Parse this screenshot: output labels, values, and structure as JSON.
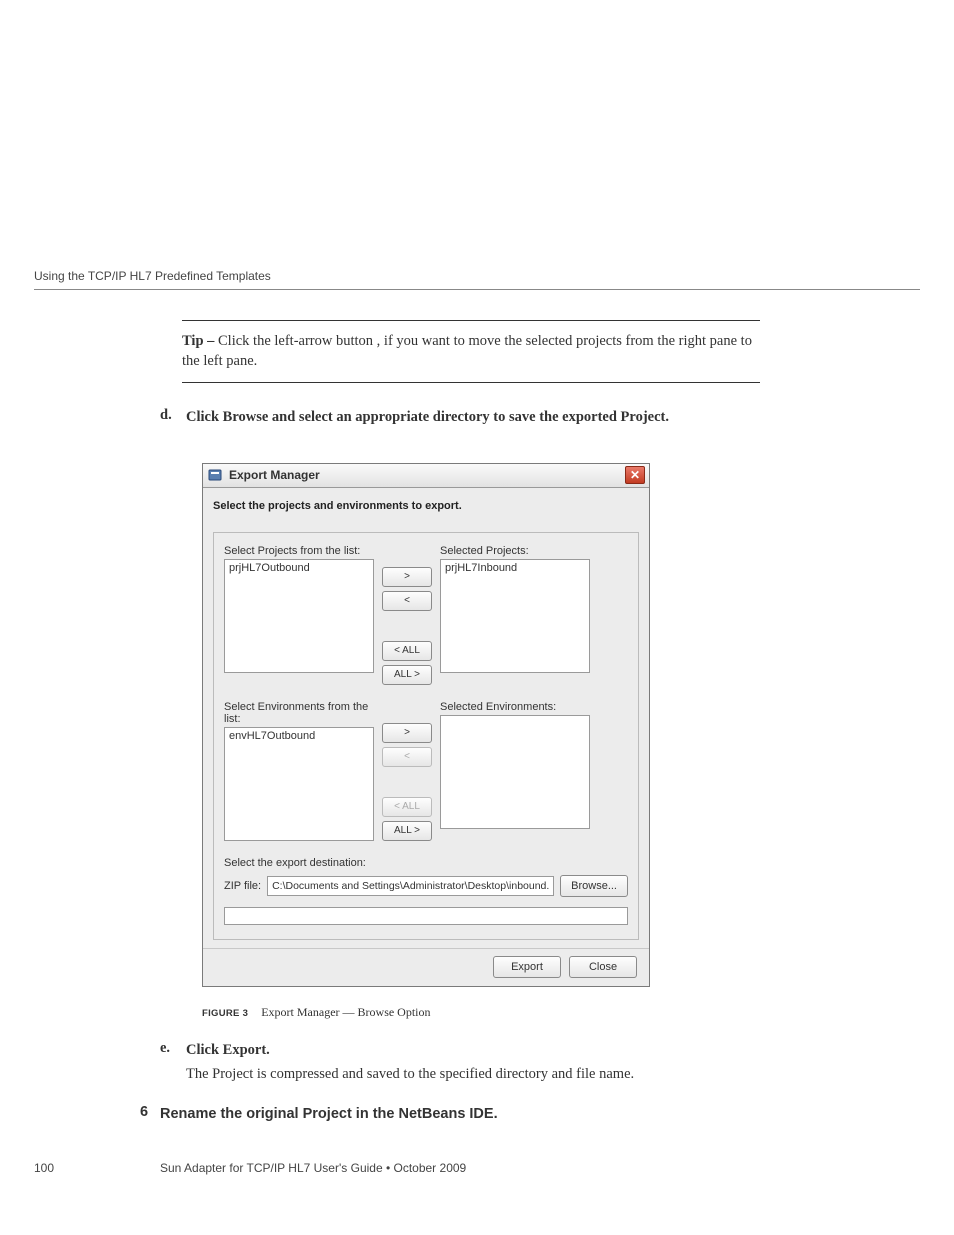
{
  "header": {
    "section_title": "Using the TCP/IP HL7 Predefined Templates"
  },
  "tip": {
    "label": "Tip –",
    "text": " Click the left-arrow button , if you want to move the selected projects from the right pane to the left pane."
  },
  "steps": {
    "d": {
      "marker": "d.",
      "text": "Click Browse and select an appropriate directory to save the exported Project."
    },
    "e": {
      "marker": "e.",
      "title": "Click Export.",
      "body": "The Project is compressed and saved to the specified directory and file name."
    },
    "six": {
      "marker": "6",
      "text": "Rename the original Project in the NetBeans IDE."
    }
  },
  "dialog": {
    "title": "Export Manager",
    "close_glyph": "✕",
    "heading": "Select the projects and environments to export.",
    "projects": {
      "left_label": "Select Projects from the list:",
      "left_items": [
        "prjHL7Outbound"
      ],
      "right_label": "Selected Projects:",
      "right_items": [
        "prjHL7Inbound"
      ]
    },
    "environments": {
      "left_label": "Select Environments from the list:",
      "left_items": [
        "envHL7Outbound"
      ],
      "right_label": "Selected Environments:",
      "right_items": []
    },
    "xfer": {
      "right": ">",
      "left": "<",
      "all_left": "< ALL",
      "all_right": "ALL >"
    },
    "dest": {
      "label": "Select the export destination:",
      "zip_label": "ZIP file:",
      "zip_value": "C:\\Documents and Settings\\Administrator\\Desktop\\inbound.zip",
      "browse_label": "Browse..."
    },
    "footer": {
      "export_label": "Export",
      "close_label": "Close"
    }
  },
  "figure": {
    "label": "FIGURE 3",
    "caption": "Export Manager — Browse Option"
  },
  "footer": {
    "page_number": "100",
    "doc_title": "Sun Adapter for TCP/IP HL7 User's Guide   •   October 2009"
  }
}
